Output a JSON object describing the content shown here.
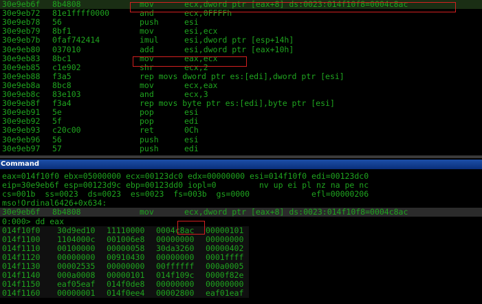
{
  "disasm": {
    "rows": [
      {
        "addr": "30e9eb6f",
        "bytes": "8b4808",
        "mnem": "mov",
        "ops": "ecx,dword ptr [eax+8] ds:0023:014f10f8=0004c8ac"
      },
      {
        "addr": "30e9eb72",
        "bytes": "81e1ffff0000",
        "mnem": "and",
        "ops": "ecx,0FFFFh"
      },
      {
        "addr": "30e9eb78",
        "bytes": "56",
        "mnem": "push",
        "ops": "esi"
      },
      {
        "addr": "30e9eb79",
        "bytes": "8bf1",
        "mnem": "mov",
        "ops": "esi,ecx"
      },
      {
        "addr": "30e9eb7b",
        "bytes": "0faf742414",
        "mnem": "imul",
        "ops": "esi,dword ptr [esp+14h]"
      },
      {
        "addr": "30e9eb80",
        "bytes": "037010",
        "mnem": "add",
        "ops": "esi,dword ptr [eax+10h]"
      },
      {
        "addr": "30e9eb83",
        "bytes": "8bc1",
        "mnem": "mov",
        "ops": "eax,ecx"
      },
      {
        "addr": "30e9eb85",
        "bytes": "c1e902",
        "mnem": "shr",
        "ops": "ecx,2"
      },
      {
        "addr": "30e9eb88",
        "bytes": "f3a5",
        "mnem": "rep movs dword ptr es:[edi],dword ptr [esi]",
        "ops": ""
      },
      {
        "addr": "30e9eb8a",
        "bytes": "8bc8",
        "mnem": "mov",
        "ops": "ecx,eax"
      },
      {
        "addr": "30e9eb8c",
        "bytes": "83e103",
        "mnem": "and",
        "ops": "ecx,3"
      },
      {
        "addr": "30e9eb8f",
        "bytes": "f3a4",
        "mnem": "rep movs byte ptr es:[edi],byte ptr [esi]",
        "ops": ""
      },
      {
        "addr": "30e9eb91",
        "bytes": "5e",
        "mnem": "pop",
        "ops": "esi"
      },
      {
        "addr": "30e9eb92",
        "bytes": "5f",
        "mnem": "pop",
        "ops": "edi"
      },
      {
        "addr": "30e9eb93",
        "bytes": "c20c00",
        "mnem": "ret",
        "ops": "0Ch"
      },
      {
        "addr": "30e9eb96",
        "bytes": "56",
        "mnem": "push",
        "ops": "esi"
      },
      {
        "addr": "30e9eb97",
        "bytes": "57",
        "mnem": "push",
        "ops": "edi"
      }
    ]
  },
  "command": {
    "title": "Command",
    "registers": [
      "eax=014f10f0 ebx=05000000 ecx=00123dc0 edx=00000000 esi=014f10f0 edi=00123dc0",
      "eip=30e9eb6f esp=00123d9c ebp=00123dd0 iopl=0         nv up ei pl nz na pe nc",
      "cs=001b  ss=0023  ds=0023  es=0023  fs=003b  gs=0000             efl=00000206"
    ],
    "symbol": "mso!Ordinal6426+0x634:",
    "current": {
      "addr": "30e9eb6f",
      "bytes": "8b4808",
      "mnem": "mov",
      "ops": "ecx,dword ptr [eax+8] ds:0023:014f10f8=0004c8ac"
    },
    "prompt": "0:000> dd eax",
    "dump": [
      {
        "addr": "014f10f0",
        "d": [
          "30d9ed10",
          "11110000",
          "0004c8ac",
          "00000101"
        ]
      },
      {
        "addr": "014f1100",
        "d": [
          "1104000c",
          "001006e8",
          "00000000",
          "00000000"
        ]
      },
      {
        "addr": "014f1110",
        "d": [
          "00100000",
          "00000058",
          "30da3260",
          "00000402"
        ]
      },
      {
        "addr": "014f1120",
        "d": [
          "00000000",
          "00910430",
          "00000000",
          "0001ffff"
        ]
      },
      {
        "addr": "014f1130",
        "d": [
          "00002535",
          "00000000",
          "00ffffff",
          "000a0005"
        ]
      },
      {
        "addr": "014f1140",
        "d": [
          "000a0008",
          "00000101",
          "014f109c",
          "0000f82e"
        ]
      },
      {
        "addr": "014f1150",
        "d": [
          "eaf05eaf",
          "014f0de8",
          "00000000",
          "00000000"
        ]
      },
      {
        "addr": "014f1160",
        "d": [
          "00000001",
          "014f0ee4",
          "00002800",
          "eaf01eaf"
        ]
      }
    ]
  }
}
